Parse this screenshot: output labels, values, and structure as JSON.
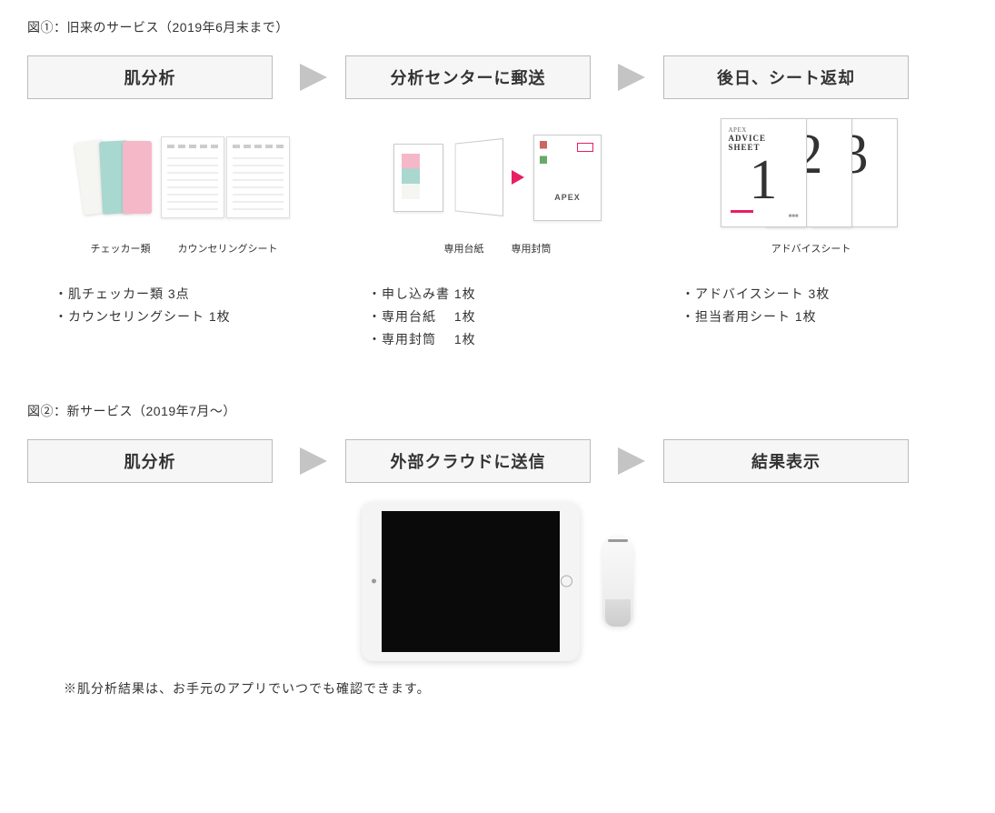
{
  "fig1": {
    "title": "図①：旧来のサービス（2019年6月末まで）",
    "steps": [
      "肌分析",
      "分析センターに郵送",
      "後日、シート返却"
    ],
    "cols": [
      {
        "captions": [
          "チェッカー類",
          "カウンセリングシート"
        ],
        "bullets": "・肌チェッカー類 3点\n・カウンセリングシート 1枚"
      },
      {
        "captions": [
          "専用台紙",
          "専用封筒"
        ],
        "bullets": "・申し込み書 1枚\n・専用台紙　 1枚\n・専用封筒　 1枚"
      },
      {
        "captions": [
          "アドバイスシート"
        ],
        "bullets": "・アドバイスシート 3枚\n・担当者用シート 1枚"
      }
    ],
    "envelope_brand": "APEX",
    "advice_label_small": "APEX",
    "advice_label": "ADVICE\nSHEET",
    "advice_nums": [
      "1",
      "2",
      "3"
    ]
  },
  "fig2": {
    "title": "図②：新サービス（2019年7月～）",
    "steps": [
      "肌分析",
      "外部クラウドに送信",
      "結果表示"
    ],
    "note": "※肌分析結果は、お手元のアプリでいつでも確認できます。"
  }
}
